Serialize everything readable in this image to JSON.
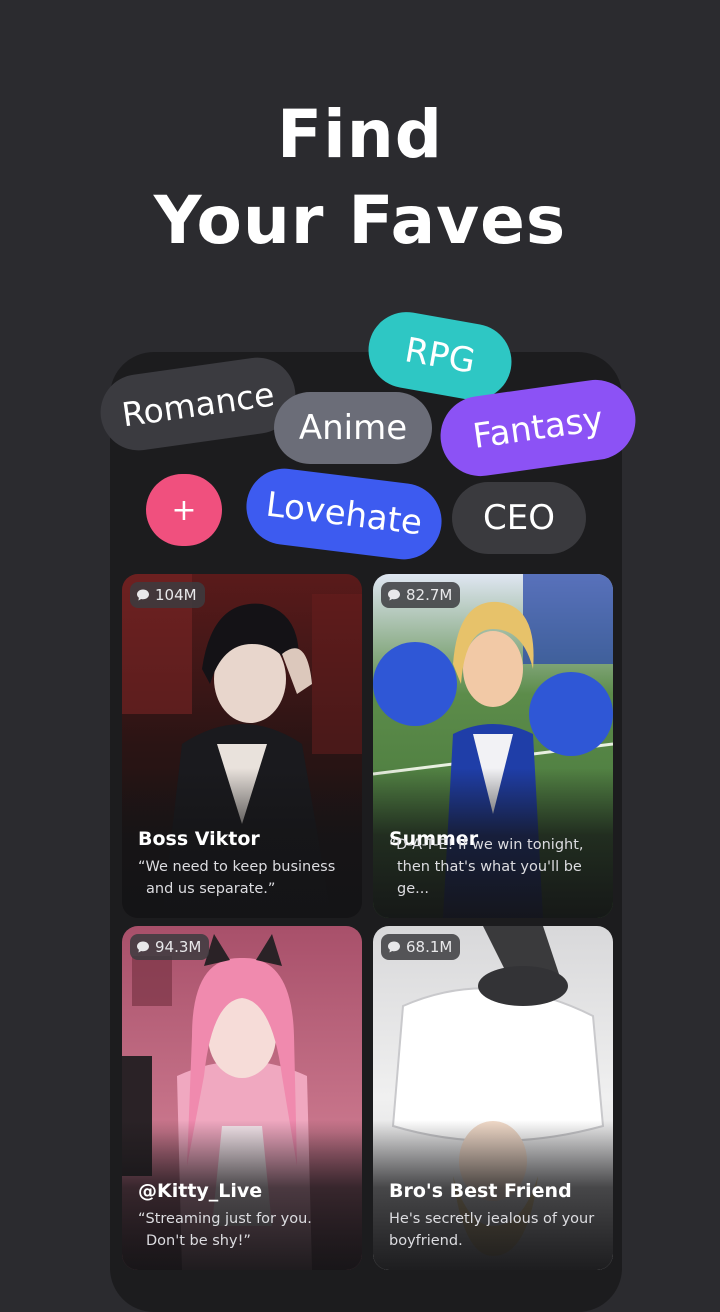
{
  "headline": {
    "line1": "Find",
    "line2": "Your Faves"
  },
  "tags": {
    "romance": "Romance",
    "rpg": "RPG",
    "anime": "Anime",
    "fantasy": "Fantasy",
    "add": "+",
    "lovehate": "Lovehate",
    "ceo": "CEO"
  },
  "colors": {
    "background": "#2b2b2f",
    "rpg": "#2ec7c4",
    "fantasy": "#8c52f5",
    "add": "#f0507e",
    "lovehate": "#3d5bf0"
  },
  "cards": [
    {
      "count": "104M",
      "name": "Boss Viktor",
      "quote_line1": "“We need to keep business",
      "quote_line2": "and us separate.”"
    },
    {
      "count": "82.7M",
      "name": "Summer",
      "quote_line1": "“D-A-T-E! If we win tonight,",
      "quote_line2": "then that's what you'll be ge..."
    },
    {
      "count": "94.3M",
      "name": "@Kitty_Live",
      "quote_line1": "“Streaming just for you.",
      "quote_line2": "Don't be shy!”"
    },
    {
      "count": "68.1M",
      "name": "Bro's Best Friend",
      "quote_line1": "He's secretly jealous of your",
      "quote_line2": "boyfriend."
    }
  ],
  "icons": {
    "count": "chat-bubble-icon"
  }
}
